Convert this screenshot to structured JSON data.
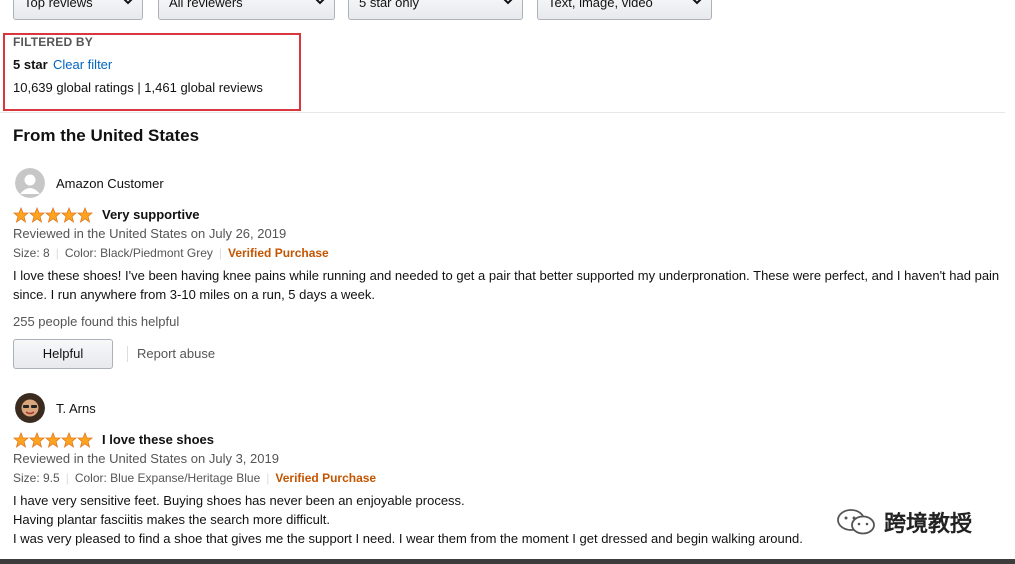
{
  "filters": {
    "sort": "Top reviews",
    "reviewer": "All reviewers",
    "stars": "5 star only",
    "format": "Text, image, video"
  },
  "filtered_by": {
    "label": "FILTERED BY",
    "star": "5 star",
    "clear": "Clear filter",
    "counts": "10,639 global ratings | 1,461 global reviews"
  },
  "section_title": "From the United States",
  "reviews": [
    {
      "name": "Amazon Customer",
      "rating": 5,
      "title": "Very supportive",
      "meta": "Reviewed in the United States on July 26, 2019",
      "size": "Size: 8",
      "color": "Color: Black/Piedmont Grey",
      "verified": "Verified Purchase",
      "body": "I love these shoes! I've been having knee pains while running and needed to get a pair that better supported my underpronation. These were perfect, and I haven't had pain since. I run anywhere from 3-10 miles on a run, 5 days a week.",
      "helpful_count": "255 people found this helpful",
      "helpful_label": "Helpful",
      "report_label": "Report abuse"
    },
    {
      "name": "T. Arns",
      "rating": 5,
      "title": "I love these shoes",
      "meta": "Reviewed in the United States on July 3, 2019",
      "size": "Size: 9.5",
      "color": "Color: Blue Expanse/Heritage Blue",
      "verified": "Verified Purchase",
      "body_lines": [
        "I have very sensitive feet. Buying shoes has never been an enjoyable process.",
        "Having plantar fasciitis makes the search more difficult.",
        "I was very pleased to find a shoe that gives me the support I need. I wear them from the moment I get dressed and begin walking around."
      ]
    }
  ],
  "watermark": {
    "text": "跨境教授",
    "icon": "wechat-icon"
  },
  "colors": {
    "link": "#0066c0",
    "verified": "#c45500",
    "star": "#ffa41c",
    "highlight_border": "#d9363e"
  }
}
